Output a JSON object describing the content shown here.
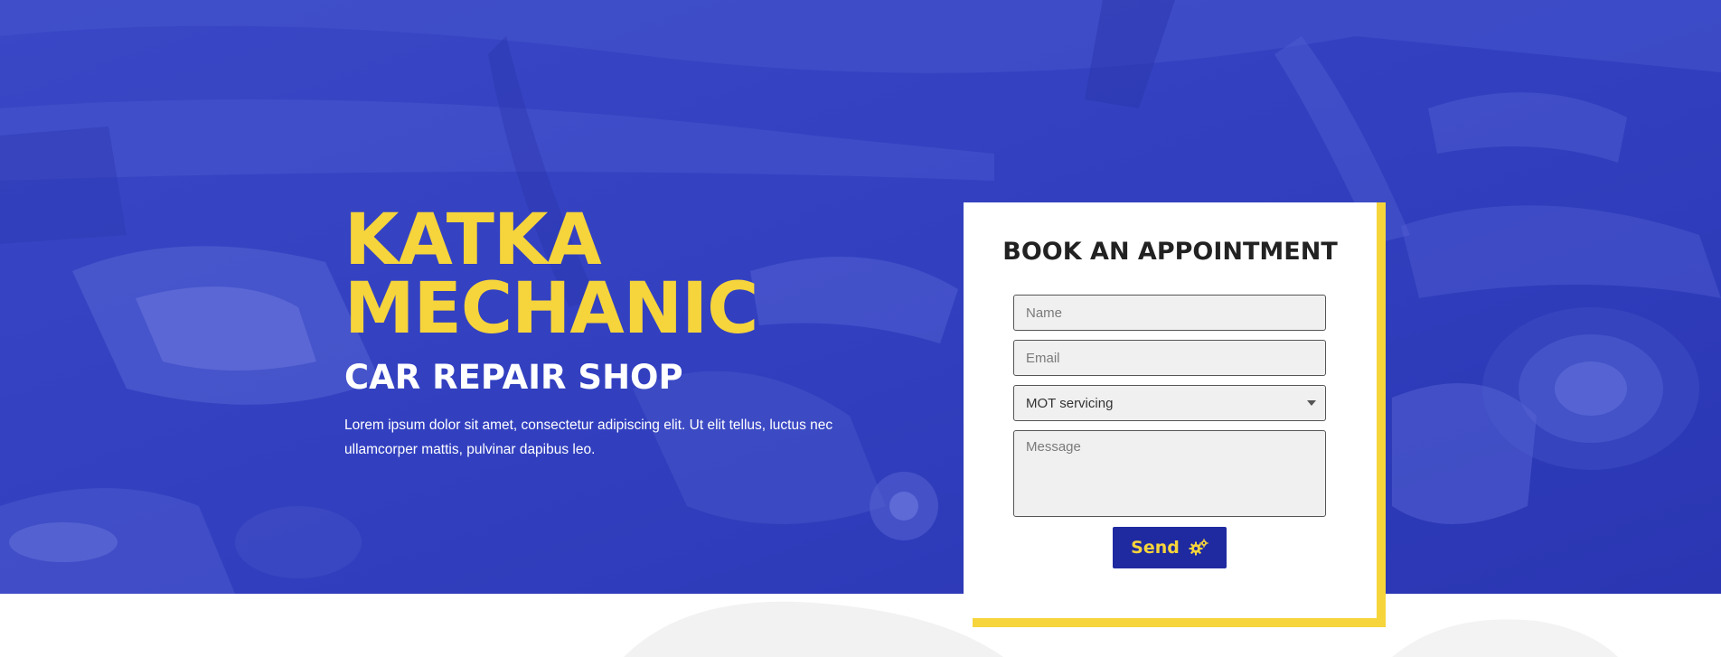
{
  "colors": {
    "hero_overlay": "#2f3dbd",
    "accent_yellow": "#f6d43b",
    "button_blue": "#1f2aa0",
    "card_bg": "#ffffff",
    "title_dark": "#222222"
  },
  "hero": {
    "title_line1": "KATKA",
    "title_line2": "MECHANIC",
    "subtitle": "CAR REPAIR SHOP",
    "description": "Lorem ipsum dolor sit amet, consectetur adipiscing elit. Ut elit tellus, luctus nec ullamcorper mattis, pulvinar dapibus leo."
  },
  "booking": {
    "title": "BOOK AN APPOINTMENT",
    "name_placeholder": "Name",
    "email_placeholder": "Email",
    "service_selected": "MOT servicing",
    "message_placeholder": "Message",
    "send_label": "Send",
    "send_icon": "gears-icon"
  }
}
